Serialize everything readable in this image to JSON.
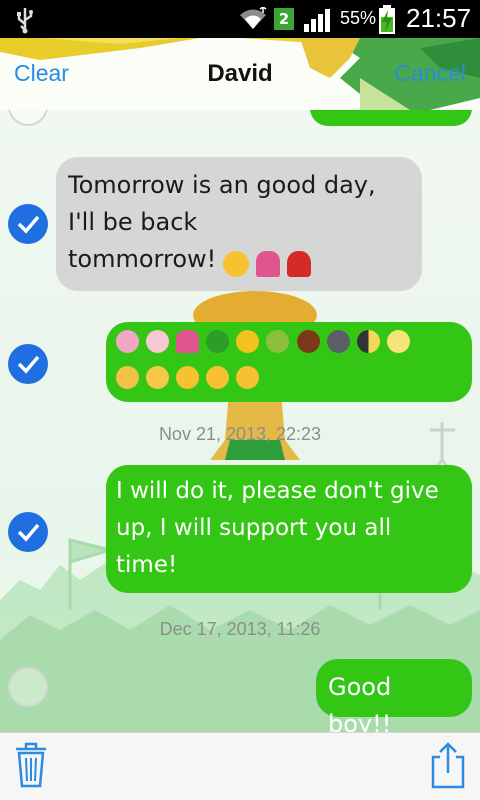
{
  "status_bar": {
    "sim_slot": "2",
    "battery_percent": "55%",
    "time": "21:57",
    "icons": [
      "usb-icon",
      "wifi-icon",
      "signal-icon",
      "battery-charging-icon"
    ]
  },
  "header": {
    "clear_label": "Clear",
    "title": "David",
    "cancel_label": "Cancel"
  },
  "messages": [
    {
      "direction": "incoming",
      "selected": true,
      "text": "Tomorrow is an good day,\nI'll be back\ntommorrow!",
      "emoji": [
        "grinning-face",
        "tulip",
        "rose"
      ]
    },
    {
      "direction": "outgoing",
      "selected": true,
      "emoji_rows": [
        [
          "bouquet",
          "cherry-blossom",
          "tulip",
          "four-leaf-clover",
          "sunflower",
          "melon",
          "chestnut",
          "new-moon-face",
          "first-quarter-moon",
          "full-moon-face"
        ],
        [
          "crying-cat",
          "screaming-face",
          "grinning-face",
          "grinning-face",
          "smiling-face"
        ]
      ]
    },
    {
      "timestamp": "Nov 21, 2013, 22:23"
    },
    {
      "direction": "outgoing",
      "selected": true,
      "text": "I will do it, please don't give\nup, I will support you all\ntime!"
    },
    {
      "timestamp": "Dec 17, 2013, 11:26"
    },
    {
      "direction": "outgoing",
      "selected": false,
      "text": "Good boy!!"
    }
  ],
  "ts1": "Nov 21, 2013, 22:23",
  "ts2": "Dec 17, 2013, 11:26",
  "bottom_bar": {
    "icons": [
      "trash-icon",
      "share-icon"
    ]
  },
  "colors": {
    "accent_blue": "#2a8be0",
    "check_blue": "#1f6fe0",
    "outgoing_bubble": "#33c615",
    "incoming_bubble": "#d5d7d6"
  }
}
